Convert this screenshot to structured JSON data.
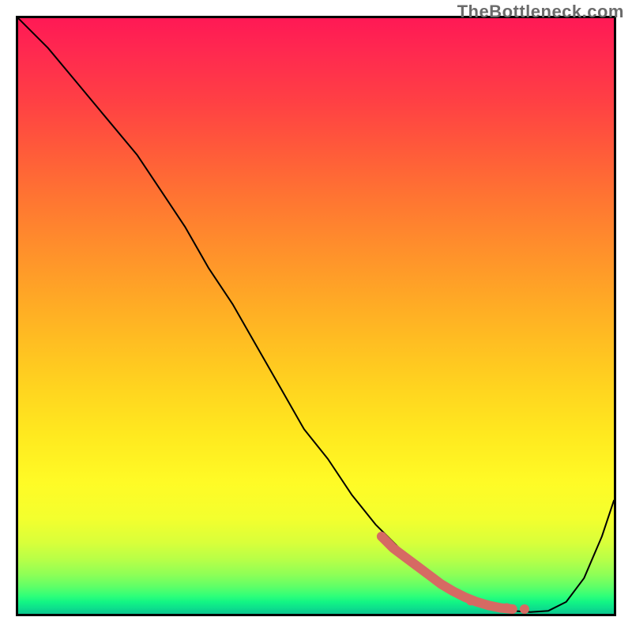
{
  "watermark": "TheBottleneck.com",
  "colors": {
    "frame": "#000000",
    "line": "#000000",
    "marker": "#d66a63",
    "watermark": "#6b6b6b"
  },
  "chart_data": {
    "type": "line",
    "title": "",
    "xlabel": "",
    "ylabel": "",
    "xlim": [
      0,
      100
    ],
    "ylim": [
      0,
      100
    ],
    "grid": false,
    "series": [
      {
        "name": "curve",
        "x": [
          0,
          5,
          10,
          15,
          20,
          24,
          28,
          32,
          36,
          40,
          44,
          48,
          52,
          56,
          60,
          64,
          68,
          72,
          76,
          80,
          83,
          86,
          89,
          92,
          95,
          98,
          100
        ],
        "y": [
          100,
          95,
          89,
          83,
          77,
          71,
          65,
          58,
          52,
          45,
          38,
          31,
          26,
          20,
          15,
          11,
          8,
          5,
          3,
          1,
          0.5,
          0.3,
          0.5,
          2,
          6,
          13,
          19
        ]
      }
    ],
    "highlighted_segment": {
      "name": "highlight",
      "x": [
        61,
        63,
        65,
        67,
        69,
        71,
        73,
        75,
        77,
        79,
        81,
        83
      ],
      "y": [
        13,
        11,
        9.5,
        8,
        6.5,
        5,
        3.8,
        2.8,
        2,
        1.4,
        1,
        0.8
      ]
    },
    "highlighted_dots": {
      "name": "dots",
      "x": [
        76,
        79,
        82,
        85
      ],
      "y": [
        2.2,
        1.4,
        1.0,
        0.8
      ]
    },
    "gradient_stops": [
      {
        "pos": 0,
        "color": "#ff1955"
      },
      {
        "pos": 14,
        "color": "#ff4044"
      },
      {
        "pos": 30,
        "color": "#ff7432"
      },
      {
        "pos": 46,
        "color": "#ffa526"
      },
      {
        "pos": 62,
        "color": "#ffd41f"
      },
      {
        "pos": 78,
        "color": "#fffb26"
      },
      {
        "pos": 91,
        "color": "#b6ff48"
      },
      {
        "pos": 97,
        "color": "#2fff79"
      },
      {
        "pos": 100,
        "color": "#0bc78e"
      }
    ]
  }
}
